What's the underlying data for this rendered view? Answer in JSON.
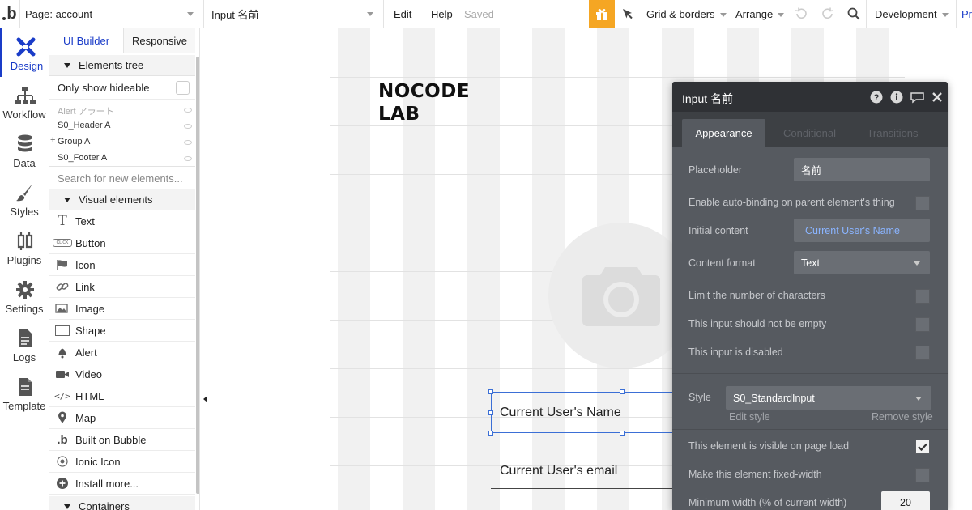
{
  "topbar": {
    "logo": "b",
    "page_selector": "Page: account",
    "element_selector": "Input 名前",
    "edit": "Edit",
    "help": "Help",
    "saved": "Saved",
    "grid_borders": "Grid & borders",
    "arrange": "Arrange",
    "environment": "Development",
    "preview_partial": "Pr",
    "gift_color": "#f5a623"
  },
  "leftnav": {
    "items": [
      {
        "label": "Design",
        "icon": "design-icon"
      },
      {
        "label": "Workflow",
        "icon": "workflow-icon"
      },
      {
        "label": "Data",
        "icon": "data-icon"
      },
      {
        "label": "Styles",
        "icon": "styles-icon"
      },
      {
        "label": "Plugins",
        "icon": "plugins-icon"
      },
      {
        "label": "Settings",
        "icon": "gear-icon"
      },
      {
        "label": "Logs",
        "icon": "logs-icon"
      },
      {
        "label": "Template",
        "icon": "template-icon"
      }
    ],
    "active_color": "#1a3cc8"
  },
  "palette": {
    "tabs": [
      "UI Builder",
      "Responsive"
    ],
    "elements_tree_title": "Elements tree",
    "only_show_hideable": "Only show hideable",
    "tree_items": [
      "Alert アラート",
      "S0_Header A",
      "Group A",
      "S0_Footer A"
    ],
    "search_placeholder": "Search for new elements...",
    "visual_elements_title": "Visual elements",
    "visual_elements": [
      {
        "label": "Text",
        "icon": "text-icon"
      },
      {
        "label": "Button",
        "icon": "button-icon"
      },
      {
        "label": "Icon",
        "icon": "flag-icon"
      },
      {
        "label": "Link",
        "icon": "link-icon"
      },
      {
        "label": "Image",
        "icon": "image-icon"
      },
      {
        "label": "Shape",
        "icon": "shape-icon"
      },
      {
        "label": "Alert",
        "icon": "bell-icon"
      },
      {
        "label": "Video",
        "icon": "video-icon"
      },
      {
        "label": "HTML",
        "icon": "code-icon"
      },
      {
        "label": "Map",
        "icon": "map-pin-icon"
      },
      {
        "label": "Built on Bubble",
        "icon": "bubble-icon"
      },
      {
        "label": "Ionic Icon",
        "icon": "ionic-icon"
      },
      {
        "label": "Install more...",
        "icon": "plus-circle-icon"
      }
    ],
    "button_icon_text": "CLICK",
    "containers_title": "Containers"
  },
  "canvas": {
    "brand_line1": "NOCODE",
    "brand_line2": "LAB",
    "name_input": "Current User's Name",
    "email_input": "Current User's email"
  },
  "editor": {
    "title": "Input 名前",
    "tabs": [
      "Appearance",
      "Conditional",
      "Transitions"
    ],
    "placeholder_label": "Placeholder",
    "placeholder_value": "名前",
    "auto_binding_label": "Enable auto-binding on parent element's thing",
    "initial_content_label": "Initial content",
    "initial_content_value": "Current User's Name",
    "content_format_label": "Content format",
    "content_format_value": "Text",
    "limit_chars_label": "Limit the number of characters",
    "not_empty_label": "This input should not be empty",
    "disabled_label": "This input is disabled",
    "style_label": "Style",
    "style_value": "S0_StandardInput",
    "edit_style": "Edit style",
    "remove_style": "Remove style",
    "visible_label": "This element is visible on page load",
    "visible_checked": true,
    "fixed_width_label": "Make this element fixed-width",
    "min_width_label": "Minimum width (% of current width)",
    "min_width_value": "20"
  }
}
